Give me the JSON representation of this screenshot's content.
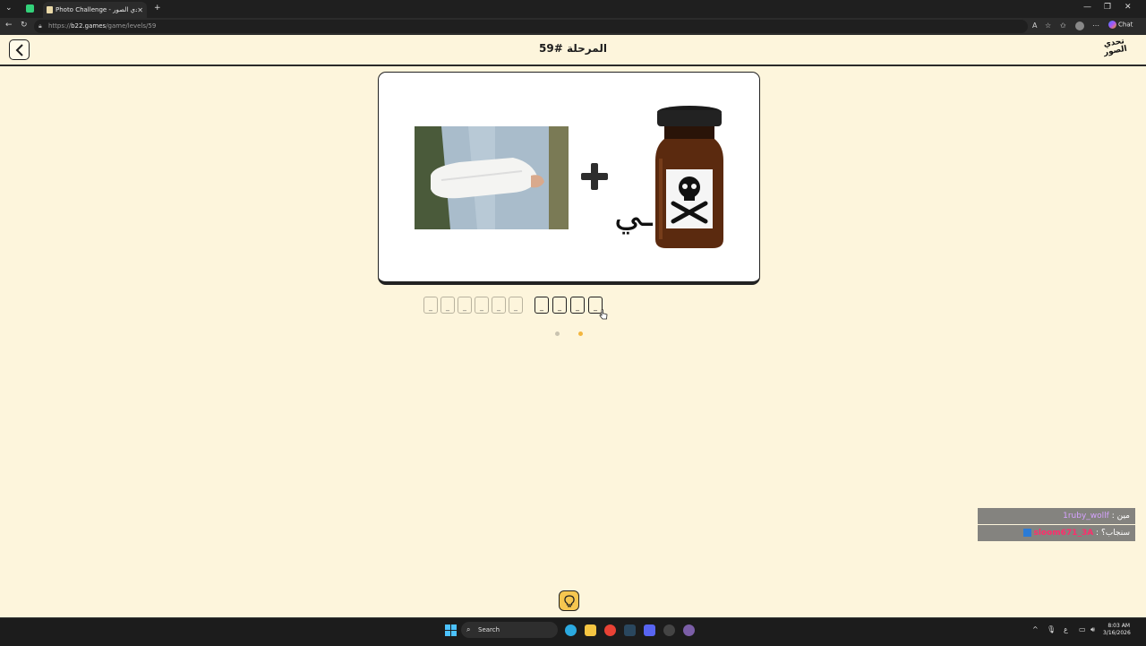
{
  "browser": {
    "tab_title": "Photo Challenge - لعبة تحدي الصور",
    "tab_close": "✕",
    "new_tab": "+",
    "url_scheme": "https://",
    "url_host": "b22.games",
    "url_path": "/game/levels/59",
    "chat_label": "Chat"
  },
  "game": {
    "level_title": "المرحلة #59",
    "logo_line1": "تحدي",
    "logo_line2": "الصور",
    "clue_letter": "ـي",
    "word1_tiles": [
      "_",
      "_",
      "_",
      "_",
      "_",
      "_"
    ],
    "word2_tiles": [
      "_",
      "_",
      "_",
      "_"
    ],
    "pager_dots": [
      {
        "color": "#c9c3b0"
      },
      {
        "color": "#f3b63f"
      }
    ]
  },
  "chat": {
    "messages": [
      {
        "user": "1ruby_wollf",
        "text": "مين :"
      },
      {
        "user": "sloom671_3A",
        "text": "سنجاب؟ :"
      }
    ]
  },
  "taskbar": {
    "search_label": "Search",
    "time": "8:03 AM",
    "date": "3/16/2026"
  },
  "colors": {
    "background": "#fdf5dc",
    "hint_button": "#f6c650",
    "active_dot": "#f3b63f"
  }
}
